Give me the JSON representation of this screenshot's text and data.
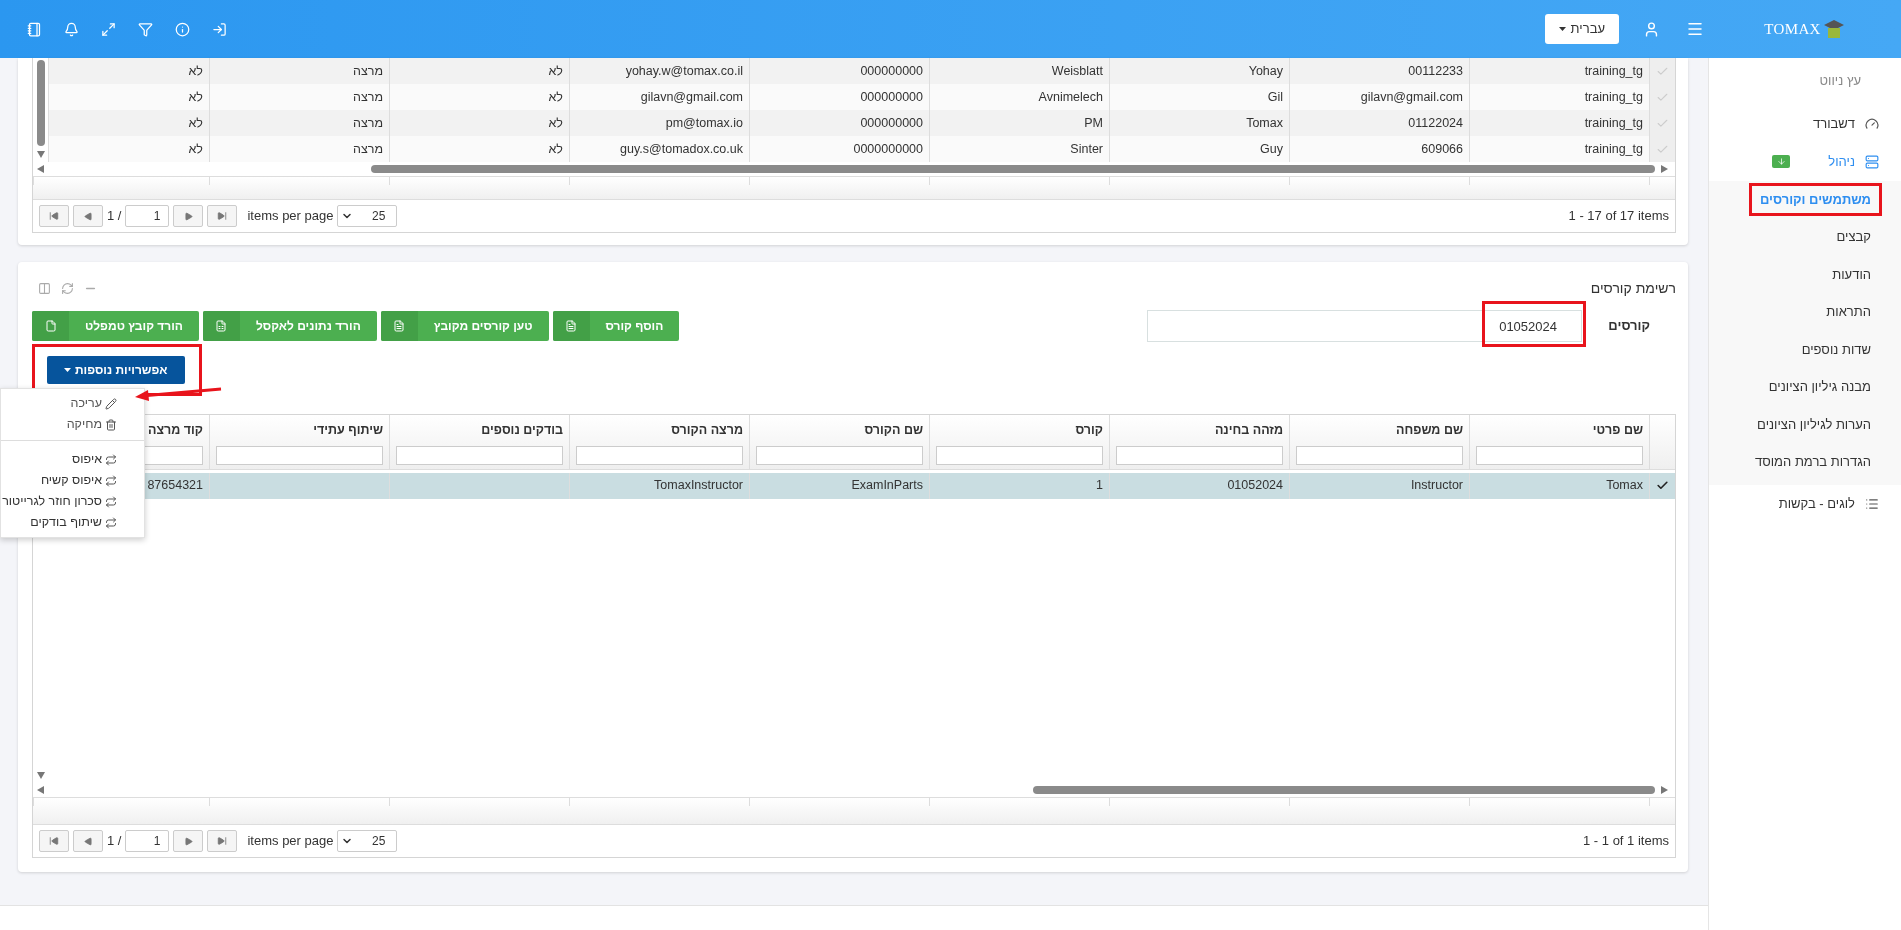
{
  "topbar": {
    "logo": "TOMAX",
    "language": "עברית"
  },
  "sidebar": {
    "heading": "עץ ניווט",
    "items": [
      {
        "label": "דשבורד"
      },
      {
        "label": "ניהול",
        "expanded": true,
        "children": [
          {
            "label": "משתמשים וקורסים",
            "selected": true,
            "highlighted": true
          },
          {
            "label": "קבצים",
            "selected": false,
            "highlighted": false
          },
          {
            "label": "הודעות",
            "selected": false,
            "highlighted": false
          },
          {
            "label": "התראות",
            "selected": false,
            "highlighted": false
          },
          {
            "label": "שדות נוספים",
            "selected": false,
            "highlighted": false
          },
          {
            "label": "מבנה גיליון הציונים",
            "selected": false,
            "highlighted": false
          },
          {
            "label": "הערות לגיליון הציונים",
            "selected": false,
            "highlighted": false
          },
          {
            "label": "הגדרות ברמת המוסד",
            "selected": false,
            "highlighted": false
          }
        ]
      },
      {
        "label": "לוגים - בקשות"
      }
    ]
  },
  "users_table": {
    "rows": [
      {
        "selected": false,
        "cells": [
          "training_tg",
          "00112233",
          "Yohay",
          "Weisblatt",
          "000000000",
          "yohay.w@tomax.co.il",
          "לא",
          "מרצה",
          "לא"
        ]
      },
      {
        "selected": false,
        "cells": [
          "training_tg",
          "gilavn@gmail.com",
          "Gil",
          "Avnimelech",
          "000000000",
          "gilavn@gmail.com",
          "לא",
          "מרצה",
          "לא"
        ]
      },
      {
        "selected": false,
        "cells": [
          "training_tg",
          "01122024",
          "Tomax",
          "PM",
          "000000000",
          "pm@tomax.io",
          "לא",
          "מרצה",
          "לא"
        ]
      },
      {
        "selected": false,
        "cells": [
          "training_tg",
          "609066",
          "Guy",
          "Sinter",
          "0000000000",
          "guy.s@tomadox.co.uk",
          "לא",
          "מרצה",
          "לא"
        ]
      }
    ],
    "pager": {
      "page_label": "1 /",
      "page": "1",
      "per_page_label": "items per page",
      "page_size": "25",
      "summary": "1 - 17 of 17 items"
    }
  },
  "courses_panel": {
    "title": "רשימת קורסים",
    "filter": {
      "label": "קורסים",
      "value": "01052024",
      "highlighted": true
    },
    "buttons": [
      {
        "label": "הוסף קורס",
        "kind": "file"
      },
      {
        "label": "טען קורסים מקובץ",
        "kind": "file"
      },
      {
        "label": "הורד נתונים לאקסל",
        "kind": "excel"
      },
      {
        "label": "הורד קובץ טמפלט",
        "kind": "blank"
      }
    ],
    "more_button": {
      "label": "אפשרויות נוספות",
      "highlighted": true,
      "open": true
    },
    "menu": {
      "groups": [
        [
          {
            "label": "עריכה",
            "kind": "edit",
            "pointed": true
          },
          {
            "label": "מחיקה",
            "kind": "delete",
            "pointed": false
          }
        ],
        [
          {
            "label": "איפוס",
            "kind": "sync",
            "pointed": false
          },
          {
            "label": "איפוס קשיח",
            "kind": "sync",
            "pointed": false
          },
          {
            "label": "סכרון חוזר לגרייטור",
            "kind": "sync",
            "pointed": false
          },
          {
            "label": "שיתוף בודקים",
            "kind": "sync",
            "pointed": false
          }
        ]
      ]
    },
    "table": {
      "columns": [
        "שם פרטי",
        "שם משפחה",
        "מזהה בחינה",
        "קורס",
        "שם הקורס",
        "מרצה הקורס",
        "בודקים נוספים",
        "שיתוף עתידי",
        "קוד מרצה"
      ],
      "rows": [
        {
          "selected": true,
          "cells": [
            "Tomax",
            "Instructor",
            "01052024",
            "1",
            "ExamInParts",
            "TomaxInstructor",
            null,
            null,
            "87654321"
          ]
        }
      ],
      "pager": {
        "page_label": "1 /",
        "page": "1",
        "per_page_label": "items per page",
        "page_size": "25",
        "summary": "1 - 1 of 1 items"
      }
    }
  }
}
